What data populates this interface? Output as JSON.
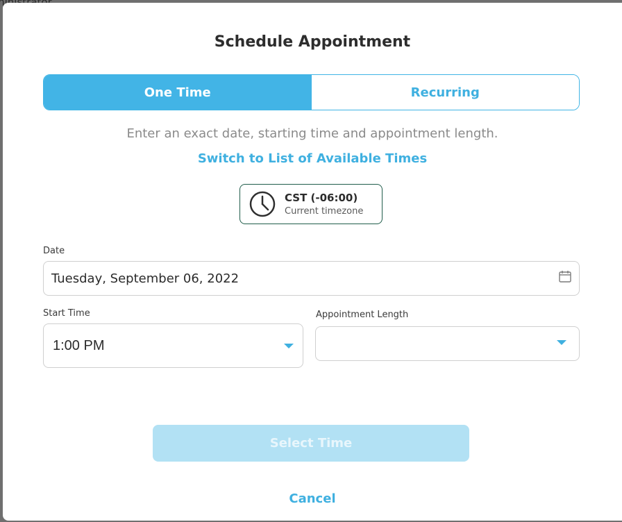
{
  "backdrop": {
    "partial_text": "ministrator"
  },
  "dialog": {
    "title": "Schedule Appointment",
    "tabs": [
      {
        "label": "One Time",
        "active": true
      },
      {
        "label": "Recurring",
        "active": false
      }
    ],
    "description": "Enter an exact date, starting time and appointment length.",
    "switch_link": "Switch to List of Available Times",
    "timezone": {
      "code": "CST (-06:00)",
      "subtitle": "Current timezone",
      "icon": "clock-icon"
    },
    "date": {
      "label": "Date",
      "value": "Tuesday, September 06, 2022",
      "icon": "calendar-icon"
    },
    "start_time": {
      "label": "Start Time",
      "value": "1:00 PM",
      "icon": "chevron-down-icon"
    },
    "length": {
      "label": "Appointment Length",
      "value": "",
      "icon": "chevron-down-icon"
    },
    "primary_button": "Select Time",
    "cancel": "Cancel"
  },
  "colors": {
    "accent": "#42b4e6",
    "accent_disabled": "#b2e1f4",
    "timezone_border": "#1f5c4a",
    "backdrop": "#6f6f6f"
  }
}
